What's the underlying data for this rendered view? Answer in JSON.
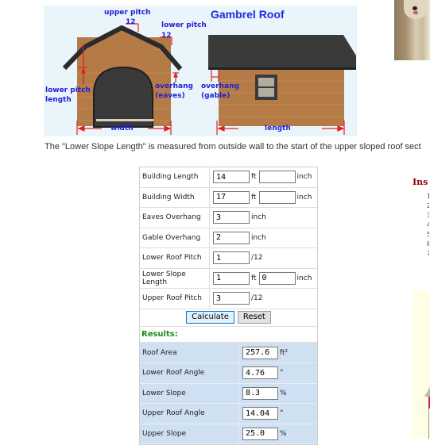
{
  "diagram": {
    "title": "Gambrel Roof",
    "labels": {
      "upper_pitch": "upper pitch",
      "upper_pitch_12": "12",
      "lower_pitch": "lower pitch",
      "lower_pitch_12": "12",
      "lower_pitch_length_1": "lower pitch",
      "lower_pitch_length_2": "length",
      "overhang_eaves_1": "overhang",
      "overhang_eaves_2": "(eaves)",
      "overhang_gable_1": "overhang",
      "overhang_gable_2": "(gable)",
      "width": "width",
      "length": "length"
    },
    "colors": {
      "label": "#1f1fd6",
      "arrow": "#e02020",
      "roof": "#2e2e2e",
      "wood": "#b57b46"
    }
  },
  "description": "The \"Lower Slope Length\" is measured from outside wall to the start of the upper sloped roof sect",
  "calculator": {
    "inputs": [
      {
        "label": "Building Length",
        "value": "14",
        "unit": "ft",
        "value2": "",
        "unit2": "inch"
      },
      {
        "label": "Building Width",
        "value": "17",
        "unit": "ft",
        "value2": "",
        "unit2": "inch"
      },
      {
        "label": "Eaves Overhang",
        "value": "3",
        "unit": "inch"
      },
      {
        "label": "Gable Overhang",
        "value": "2",
        "unit": "inch"
      },
      {
        "label": "Lower Roof Pitch",
        "value": "1",
        "unit": "/12"
      },
      {
        "label": "Lower Slope Length",
        "value": "1",
        "unit": "ft",
        "value2": "0",
        "unit2": "inch"
      },
      {
        "label": "Upper Roof Pitch",
        "value": "3",
        "unit": "/12"
      }
    ],
    "calculate_label": "Calculate",
    "reset_label": "Reset",
    "results_heading": "Results:",
    "results": [
      {
        "label": "Roof Area",
        "value": "257.6",
        "unit": "ft²"
      },
      {
        "label": "Lower Roof Angle",
        "value": "4.76",
        "unit": "°"
      },
      {
        "label": "Lower Slope",
        "value": "8.3",
        "unit": "%"
      },
      {
        "label": "Upper Roof Angle",
        "value": "14.04",
        "unit": "°"
      },
      {
        "label": "Upper Slope",
        "value": "25.0",
        "unit": "%"
      }
    ]
  },
  "sidebar": {
    "instructions_heading": "Ins",
    "list_markers": [
      "1",
      "2",
      "3",
      "4",
      "5",
      "6",
      "7"
    ]
  }
}
